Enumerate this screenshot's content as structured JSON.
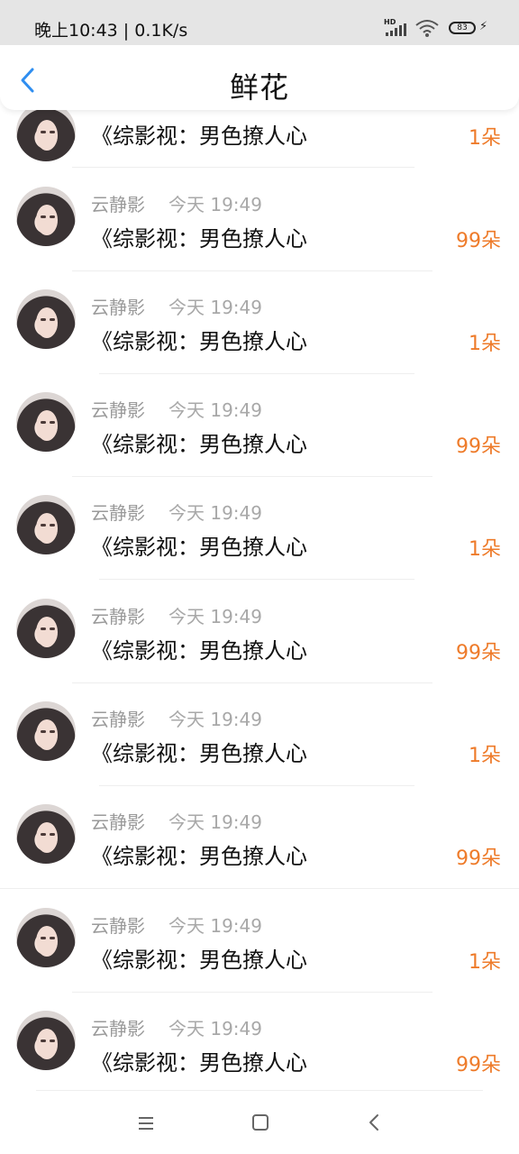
{
  "status_bar": {
    "time": "晚上10:43 | 0.1K/s",
    "hd_label": "HD",
    "battery": "83",
    "icons": [
      "signal-icon",
      "wifi-icon",
      "battery-icon",
      "charging-icon"
    ]
  },
  "header": {
    "title": "鲜花",
    "back_icon": "chevron-left-icon"
  },
  "colors": {
    "accent": "#ee7b2a",
    "back": "#2f8ef0",
    "muted": "#9a9a9a"
  },
  "partial_item": {
    "book": "《综影视：男色撩人心",
    "count": "1朵"
  },
  "items": [
    {
      "name": "云静影",
      "time": "今天 19:49",
      "book": "《综影视：男色撩人心",
      "count": "99朵"
    },
    {
      "name": "云静影",
      "time": "今天 19:49",
      "book": "《综影视：男色撩人心",
      "count": "1朵"
    },
    {
      "name": "云静影",
      "time": "今天 19:49",
      "book": "《综影视：男色撩人心",
      "count": "99朵"
    },
    {
      "name": "云静影",
      "time": "今天 19:49",
      "book": "《综影视：男色撩人心",
      "count": "1朵"
    },
    {
      "name": "云静影",
      "time": "今天 19:49",
      "book": "《综影视：男色撩人心",
      "count": "99朵"
    },
    {
      "name": "云静影",
      "time": "今天 19:49",
      "book": "《综影视：男色撩人心",
      "count": "1朵"
    },
    {
      "name": "云静影",
      "time": "今天 19:49",
      "book": "《综影视：男色撩人心",
      "count": "99朵"
    },
    {
      "name": "云静影",
      "time": "今天 19:49",
      "book": "《综影视：男色撩人心",
      "count": "1朵"
    },
    {
      "name": "云静影",
      "time": "今天 19:49",
      "book": "《综影视：男色撩人心",
      "count": "99朵"
    }
  ],
  "nav_bar": {
    "icons": [
      "menu-icon",
      "home-icon",
      "back-icon"
    ]
  }
}
